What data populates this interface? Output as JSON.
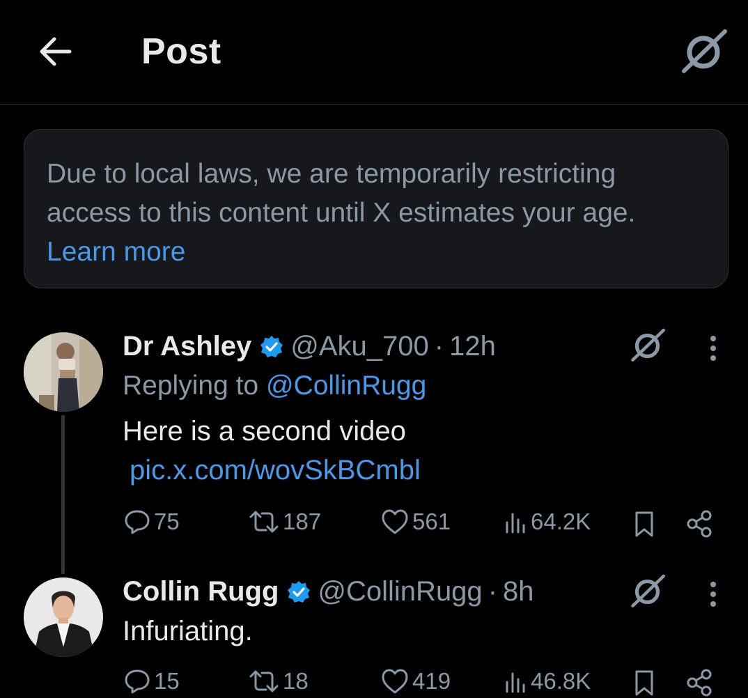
{
  "header": {
    "title": "Post"
  },
  "notice": {
    "text": "Due to local laws, we are temporarily restricting access to this content until X estimates your age.",
    "link": "Learn more"
  },
  "tweets": [
    {
      "name": "Dr Ashley",
      "handle": "@Aku_700",
      "separator": "·",
      "time": "12h",
      "replying_prefix": "Replying to ",
      "replying_to": "@CollinRugg",
      "text": "Here is a second video",
      "link": "pic.x.com/wovSkBCmbl",
      "stats": {
        "replies": "75",
        "reposts": "187",
        "likes": "561",
        "views": "64.2K"
      }
    },
    {
      "name": "Collin Rugg",
      "handle": "@CollinRugg",
      "separator": "·",
      "time": "8h",
      "text": "Infuriating.",
      "stats": {
        "replies": "15",
        "reposts": "18",
        "likes": "419",
        "views": "46.8K"
      }
    }
  ],
  "colors": {
    "background": "#000000",
    "text": "#e7e9ea",
    "muted": "#8b98a5",
    "link": "#4a99e9",
    "verified": "#1d9bf0",
    "notice_bg": "#16181c"
  },
  "icons": [
    "back-arrow-icon",
    "grok-icon",
    "verified-badge-icon",
    "more-icon",
    "reply-icon",
    "repost-icon",
    "like-icon",
    "views-icon",
    "bookmark-icon",
    "share-icon"
  ]
}
